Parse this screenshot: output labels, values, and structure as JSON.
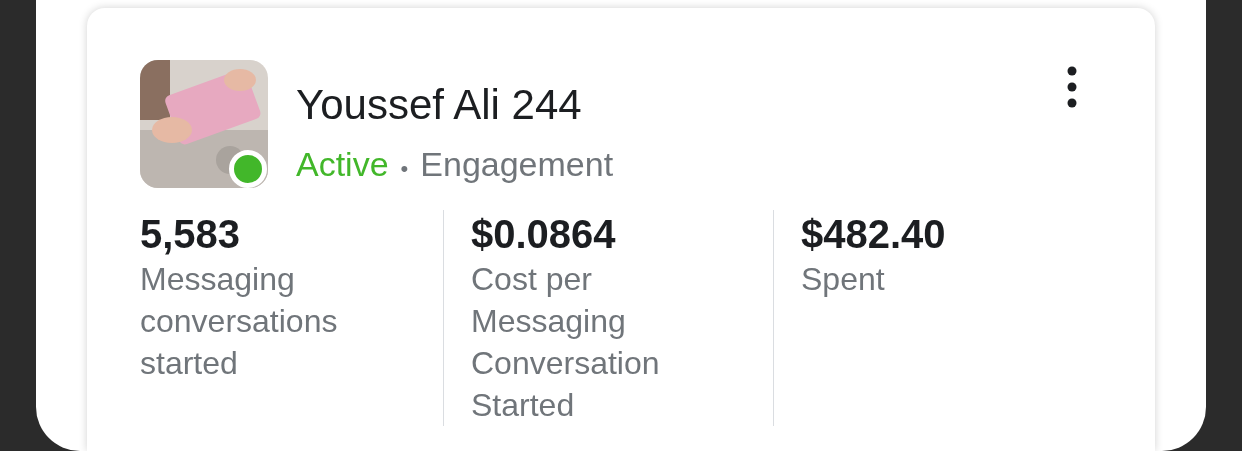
{
  "campaign": {
    "name": "Youssef Ali 244",
    "active": true,
    "status": "Active",
    "separator": "•",
    "objective": "Engagement"
  },
  "metrics": [
    {
      "value": "5,583",
      "label": "Messaging conversations started"
    },
    {
      "value": "$0.0864",
      "label": "Cost per Messaging Conversation Started"
    },
    {
      "value": "$482.40",
      "label": "Spent"
    }
  ]
}
